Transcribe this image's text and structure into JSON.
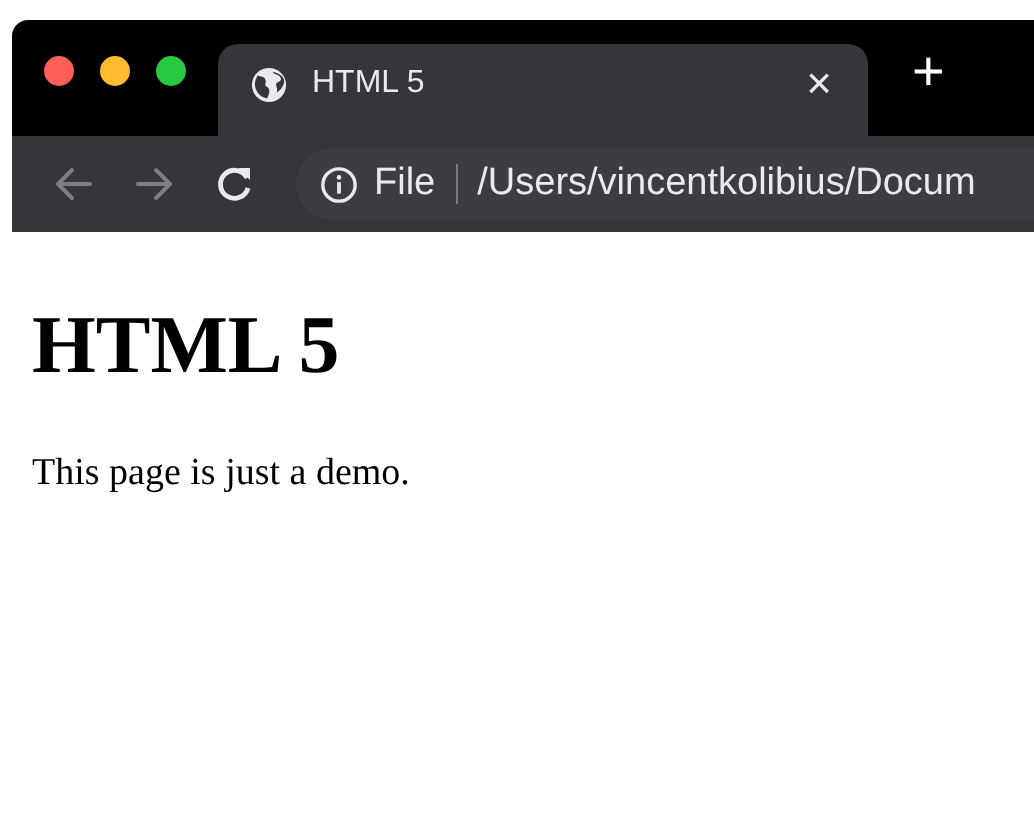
{
  "window": {
    "controls": [
      {
        "color": "#fe5f57"
      },
      {
        "color": "#febc2e"
      },
      {
        "color": "#28c840"
      }
    ]
  },
  "tabs": [
    {
      "title": "HTML 5",
      "close": "×",
      "selected": true
    }
  ],
  "new_tab": "+",
  "toolbar": {
    "back": {
      "disabled": true
    },
    "forward": {
      "disabled": true
    },
    "address": {
      "scheme": "File",
      "path": "/Users/vincentkolibius/Docum"
    }
  },
  "page": {
    "heading": "HTML 5",
    "paragraph": "This page is just a demo."
  }
}
